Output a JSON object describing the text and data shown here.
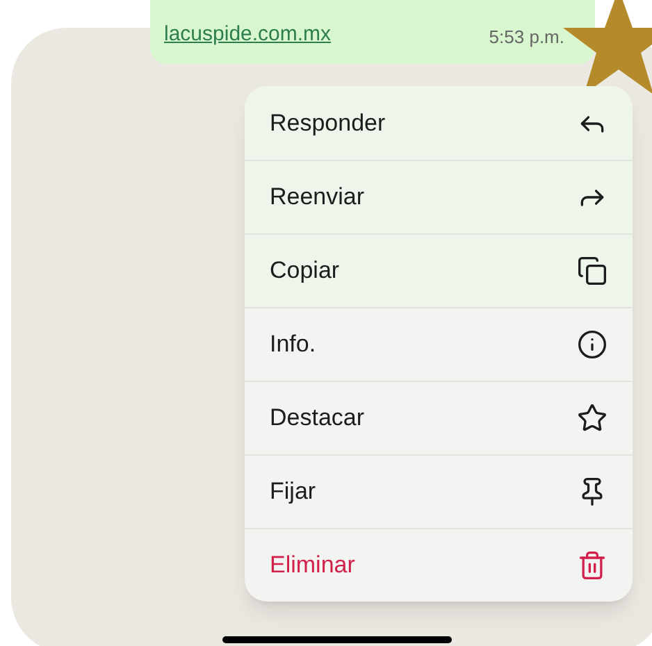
{
  "message": {
    "link": "lacuspide.com.mx",
    "time": "5:53 p.m."
  },
  "menu": [
    {
      "label": "Responder",
      "kind": "reply"
    },
    {
      "label": "Reenviar",
      "kind": "forward"
    },
    {
      "label": "Copiar",
      "kind": "copy"
    },
    {
      "label": "Info.",
      "kind": "info"
    },
    {
      "label": "Destacar",
      "kind": "star"
    },
    {
      "label": "Fijar",
      "kind": "pin"
    },
    {
      "label": "Eliminar",
      "kind": "delete"
    }
  ]
}
